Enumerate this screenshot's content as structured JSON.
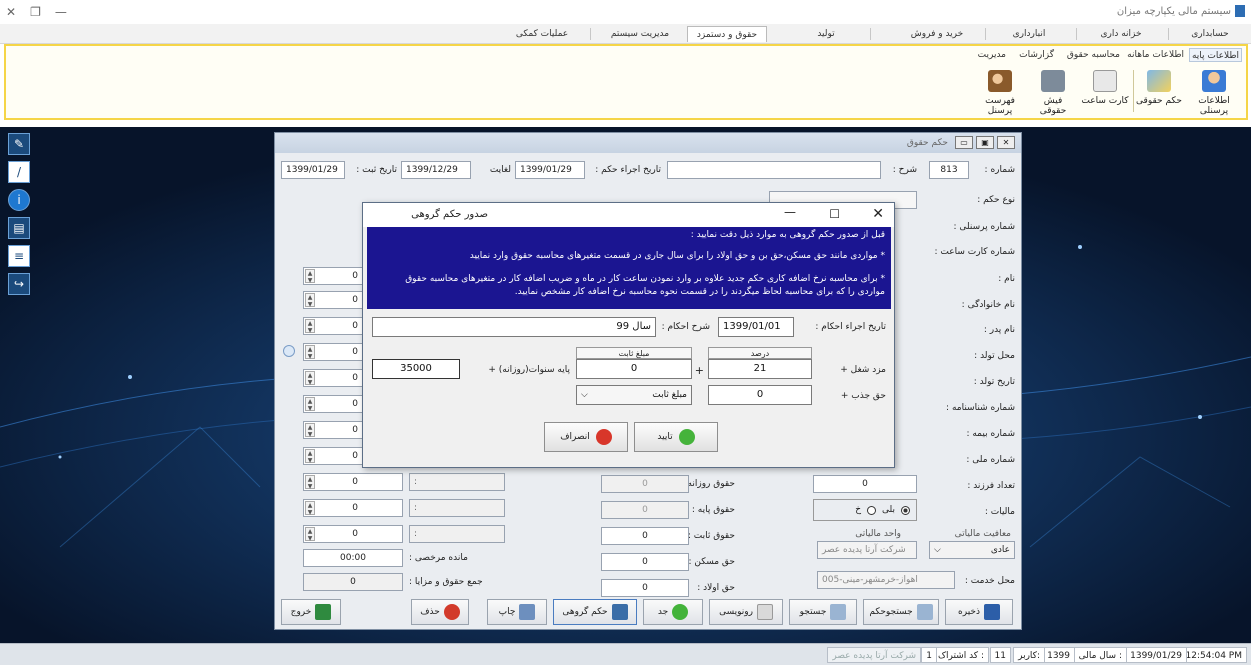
{
  "app": {
    "title": "سیستم مالی یکپارچه میزان"
  },
  "menu": {
    "items": [
      "حسابداری",
      "خزانه داری",
      "انبارداری",
      "خرید و فروش",
      "تولید",
      "حقوق و دستمزد",
      "مدیریت سیستم",
      "عملیات کمکی"
    ],
    "active_index": 5
  },
  "ribbon": {
    "subtabs": [
      "اطلاعات پایه",
      "اطلاعات ماهانه",
      "محاسبه حقوق",
      "گزارشات",
      "مدیریت"
    ],
    "buttons": [
      "اطلاعات پرسنلی",
      "حکم حقوقی",
      "کارت ساعت",
      "فیش حقوقی",
      "فهرست پرسنل"
    ]
  },
  "main_window": {
    "title": "حکم حقوق",
    "number_label": "شماره :",
    "number_value": "813",
    "desc_label": "شرح :",
    "exec_date_label": "تاریخ اجراء حکم :",
    "exec_date": "1399/01/29",
    "until_label": "لغایت",
    "until_date": "1399/12/29",
    "reg_date_label": "تاریخ ثبت :",
    "reg_date": "1399/01/29",
    "right_labels": [
      "نوع حکم :",
      "شماره پرسنلی :",
      "شماره کارت ساعت :",
      "نام :",
      "نام خانوادگی :",
      "نام پدر :",
      "محل تولد :",
      "تاریخ تولد :",
      "شماره شناسنامه :",
      "شماره بیمه :",
      "شماره ملی :",
      "تعداد فرزند :",
      "مالیات :"
    ],
    "child_count": "0",
    "tax_yes": "بلی",
    "tax_no": "خ",
    "tax_exempt_label": "معافیت مالیاتی",
    "tax_exempt_value": "عادی",
    "tax_unit_label": "واحد مالیاتی",
    "tax_unit_value": "شرکت آرتا پدیده عصر",
    "service_label": "محل خدمت :",
    "service_value": "اهواز-خرمشهر-مینی-005",
    "mid_labels": [
      "حقوق روزانه :",
      "حقوق پایه :",
      "حقوق ثابت :",
      "حق مسکن :",
      "حق اولاد :"
    ],
    "mid_values": [
      "0",
      "0",
      "0",
      "0",
      "0"
    ],
    "left_spin_values": [
      "0",
      "0",
      "0",
      "0",
      "0",
      "0",
      "0",
      "0",
      "0",
      "0",
      "0"
    ],
    "left_colon": ":",
    "remain_label": "مانده مرخصی :",
    "remain_value": "00:00",
    "sum_label": "جمع حقوق و مزایا :",
    "sum_value": "0",
    "buttons": [
      "ذخیره",
      "جستجوحکم",
      "جستجو",
      "رونویسی",
      "جد",
      "حکم گروهی",
      "چاپ",
      "حذف",
      "خروج"
    ]
  },
  "dialog": {
    "title": "صدور حکم گروهی",
    "info_lines": [
      "قبل از صدور حکم گروهی به موارد ذیل دقت نمایید :",
      "* مواردی مانند حق مسکن،حق بن و حق اولاد را برای سال جاری در قسمت متغیرهای محاسبه حقوق وارد نمایید",
      "* برای محاسبه نرخ اضافه کاری حکم جدید علاوه بر وارد نمودن ساعت کار در ماه و ضریب اضافه کار در متغیرهای محاسبه حقوق",
      "مواردی را که برای محاسبه لحاظ میگردند را در قسمت نحوه محاسبه نرخ اضافه کار مشخص نمایید."
    ],
    "exec_date_label": "تاریخ اجراء احکام :",
    "exec_date": "1399/01/01",
    "desc_label": "شرح احکام :",
    "desc_value": "سال 99",
    "percent_header": "درصد",
    "fixed_header": "مبلغ ثابت",
    "job_wage_label": "مزد شغل +",
    "job_percent": "21",
    "plus": "+",
    "job_fixed": "0",
    "base_years_label": "پایه سنوات(روزانه) +",
    "base_years_value": "35000",
    "attract_label": "حق جذب +",
    "attract_value": "0",
    "attract_type": "مبلغ ثابت",
    "ok": "تایید",
    "cancel": "انصراف"
  },
  "status": {
    "time": "12:54:04 PM",
    "date": "1399/01/29",
    "fiscal_label": "سال مالی :",
    "fiscal": "1399",
    "user_label": "کاربر:",
    "user": "11",
    "share_label": "کد اشتراک :",
    "share": "1",
    "company": "شرکت آرتا پدیده عصر"
  },
  "colors": {
    "ribbon_border": "#f5d547",
    "dialog_info": "#1b1591",
    "desktop": "#0b1b33"
  }
}
